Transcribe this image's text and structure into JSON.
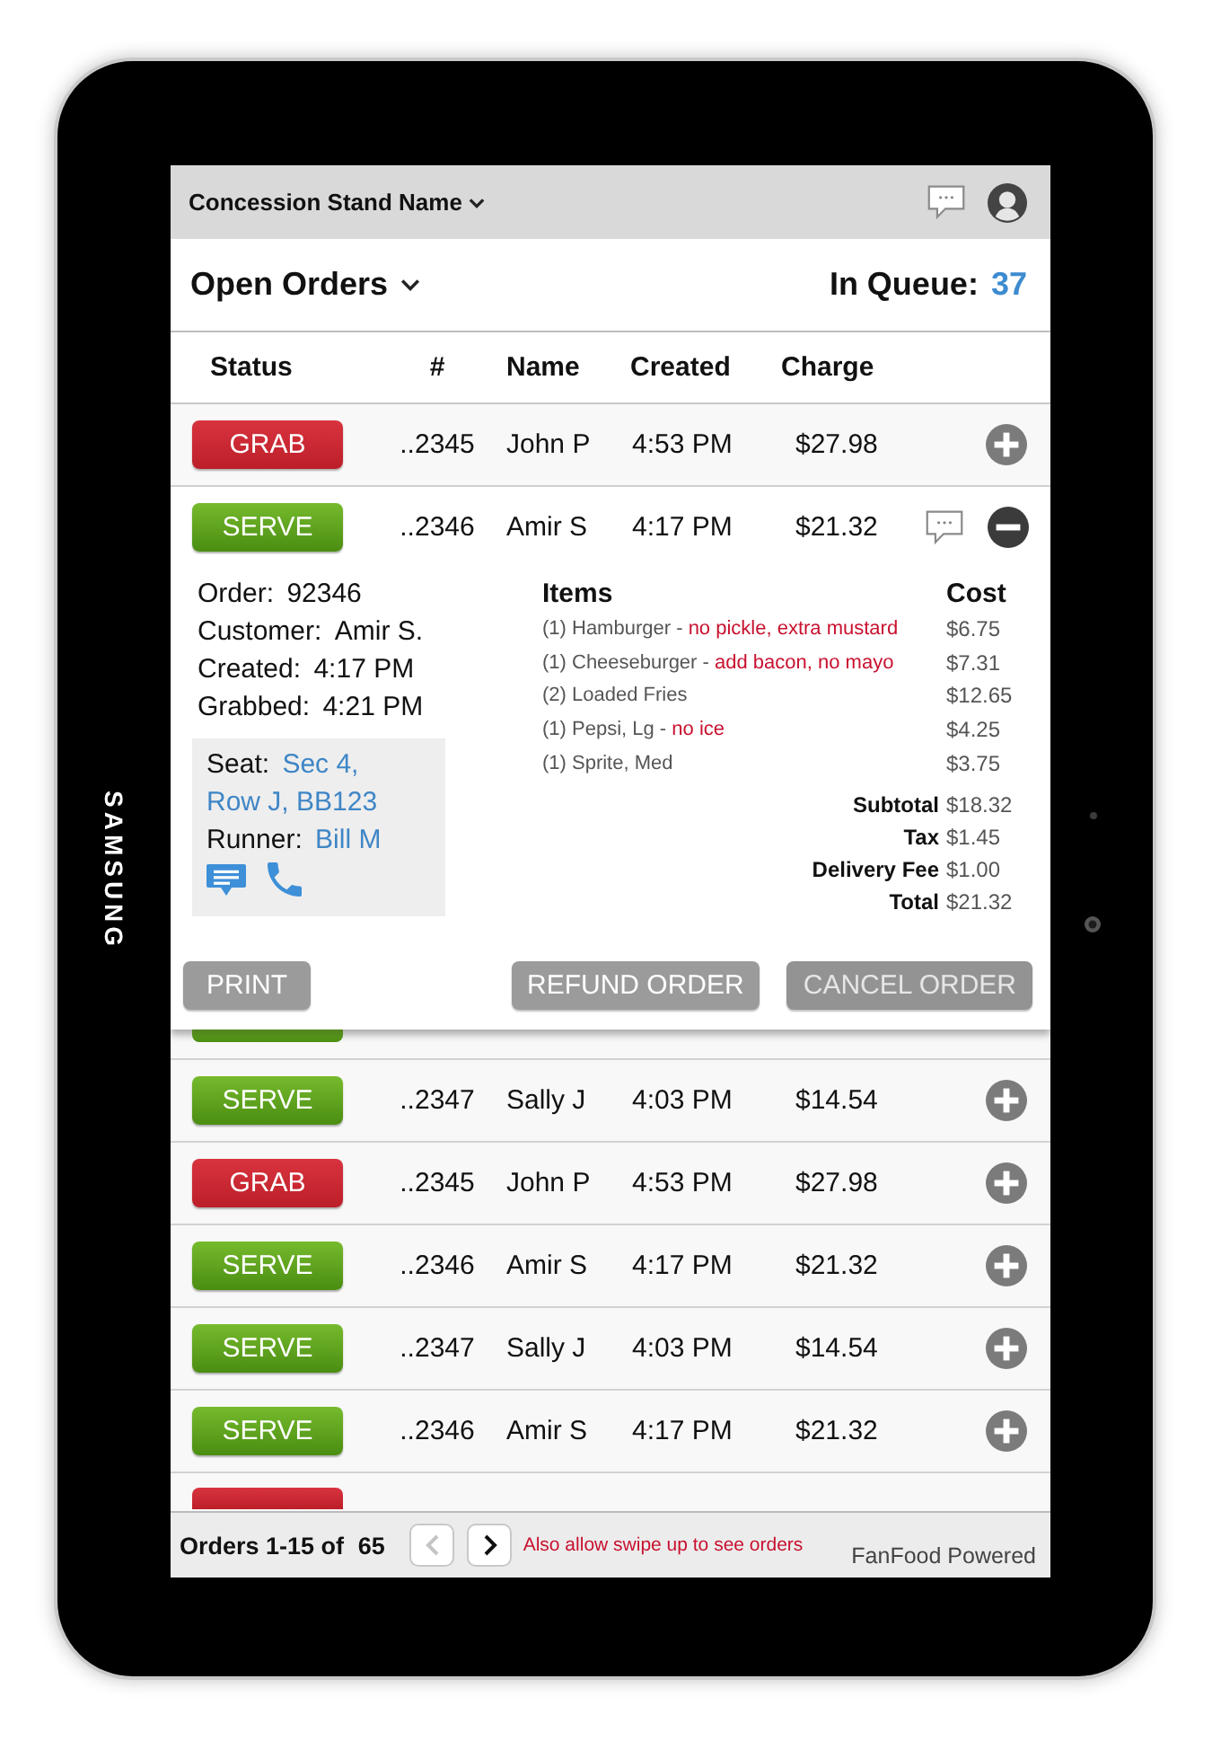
{
  "device": {
    "brand": "SAMSUNG"
  },
  "top_bar": {
    "title": "Concession Stand Name"
  },
  "header": {
    "title": "Open Orders",
    "queue_label": "In Queue:",
    "queue_count": "37"
  },
  "table": {
    "columns": [
      "Status",
      "#",
      "Name",
      "Created",
      "Charge"
    ],
    "rows": [
      {
        "kind": "grab",
        "status": "GRAB",
        "number": "..2345",
        "name": "John P",
        "created": "4:53 PM",
        "charge": "$27.98",
        "expanded": false
      },
      {
        "kind": "serve",
        "status": "SERVE",
        "number": "..2346",
        "name": "Amir S",
        "created": "4:17 PM",
        "charge": "$21.32",
        "expanded": true,
        "details": {
          "info": [
            {
              "label": "Order:",
              "value": "92346"
            },
            {
              "label": "Customer:",
              "value": "Amir S."
            },
            {
              "label": "Created:",
              "value": "4:17 PM"
            },
            {
              "label": "Grabbed:",
              "value": "4:21 PM"
            }
          ],
          "delivery": {
            "seat_label": "Seat:",
            "seat": "Sec 4, Row J, BB123",
            "runner_label": "Runner:",
            "runner": "Bill M"
          },
          "items_heading": "Items",
          "cost_heading": "Cost",
          "items": [
            {
              "item": "(1) Hamburger -",
              "note": "no pickle, extra mustard",
              "cost": "$6.75"
            },
            {
              "item": "(1) Cheeseburger -",
              "note": "add bacon, no mayo",
              "cost": "$7.31"
            },
            {
              "item": "(2) Loaded Fries",
              "cost": "$12.65"
            },
            {
              "item": "(1) Pepsi, Lg -",
              "note": "no ice",
              "cost": "$4.25"
            },
            {
              "item": "(1) Sprite, Med",
              "cost": "$3.75"
            }
          ],
          "totals": [
            {
              "label": "Subtotal",
              "value": "$18.32"
            },
            {
              "label": "Tax",
              "value": "$1.45"
            },
            {
              "label": "Delivery Fee",
              "value": "$1.00"
            },
            {
              "label": "Total",
              "value": "$21.32"
            }
          ],
          "actions": [
            {
              "label": "PRINT",
              "disabled": false
            },
            {
              "label": "REFUND ORDER",
              "disabled": false
            },
            {
              "label": "CANCEL ORDER",
              "disabled": true
            }
          ]
        }
      },
      {
        "kind": "serve",
        "covered": true
      },
      {
        "kind": "serve",
        "status": "SERVE",
        "number": "..2347",
        "name": "Sally J",
        "created": "4:03 PM",
        "charge": "$14.54",
        "expanded": false
      },
      {
        "kind": "grab",
        "status": "GRAB",
        "number": "..2345",
        "name": "John P",
        "created": "4:53 PM",
        "charge": "$27.98",
        "expanded": false
      },
      {
        "kind": "serve",
        "status": "SERVE",
        "number": "..2346",
        "name": "Amir S",
        "created": "4:17 PM",
        "charge": "$21.32",
        "expanded": false
      },
      {
        "kind": "serve",
        "status": "SERVE",
        "number": "..2347",
        "name": "Sally J",
        "created": "4:03 PM",
        "charge": "$14.54",
        "expanded": false
      },
      {
        "kind": "serve",
        "status": "SERVE",
        "number": "..2346",
        "name": "Amir S",
        "created": "4:17 PM",
        "charge": "$21.32",
        "expanded": false
      },
      {
        "kind": "grab",
        "clipped": true
      }
    ]
  },
  "footer": {
    "range_label": "Orders 1-15 of",
    "total": "65",
    "pager": [
      {
        "kind": "prev",
        "disabled": true
      },
      {
        "kind": "next",
        "disabled": false
      }
    ],
    "hint": "Also allow swipe up to see orders",
    "powered_by": "FanFood Powered"
  }
}
